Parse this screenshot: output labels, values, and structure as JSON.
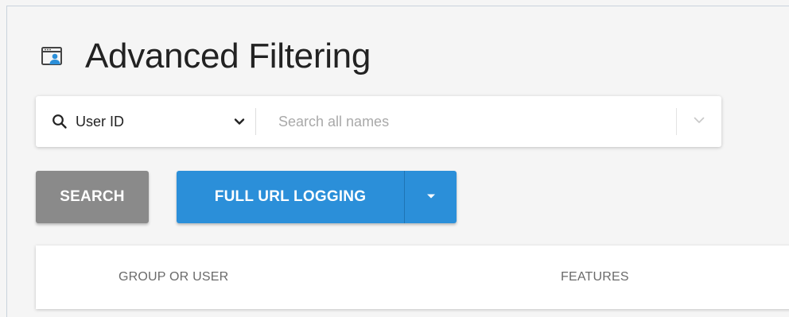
{
  "page": {
    "title": "Advanced Filtering",
    "title_icon": "window-user-icon"
  },
  "search_bar": {
    "search_icon": "search-icon",
    "field_selector": {
      "selected": "User ID",
      "icon": "chevron-down-icon"
    },
    "names_input": {
      "value": "",
      "placeholder": "Search all names"
    },
    "dropdown_icon": "chevron-down-icon"
  },
  "actions": {
    "search_label": "SEARCH",
    "full_url_logging_label": "FULL URL LOGGING",
    "menu_icon": "caret-down-icon"
  },
  "table": {
    "columns": [
      "GROUP OR USER",
      "FEATURES"
    ]
  },
  "colors": {
    "primary_blue": "#2b8fd9",
    "search_button_gray": "#8a8a8a",
    "background": "#f5f5f5"
  }
}
